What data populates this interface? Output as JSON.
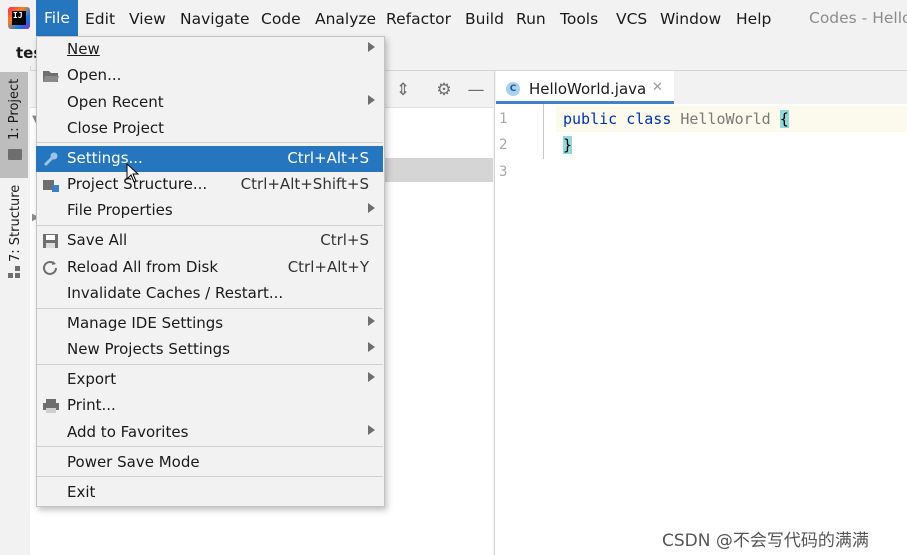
{
  "menubar": {
    "items": [
      "File",
      "Edit",
      "View",
      "Navigate",
      "Code",
      "Analyze",
      "Refactor",
      "Build",
      "Run",
      "Tools",
      "VCS",
      "Window",
      "Help"
    ],
    "window_title": "Codes - Hello"
  },
  "project": {
    "title": "tes",
    "tool_tabs": [
      "1: Project",
      "7: Structure"
    ]
  },
  "editor": {
    "tab_label": "HelloWorld.java",
    "tab_icon": "C",
    "line_numbers": [
      "1",
      "2",
      "3"
    ],
    "code_line1_kw1": "public",
    "code_line1_kw2": "class",
    "code_line1_name": "HelloWorld",
    "code_line1_brace": "{",
    "code_line2_brace": "}"
  },
  "file_menu": {
    "new": "New",
    "open": "Open...",
    "open_recent": "Open Recent",
    "close_project": "Close Project",
    "settings": "Settings...",
    "settings_sc": "Ctrl+Alt+S",
    "project_structure": "Project Structure...",
    "project_structure_sc": "Ctrl+Alt+Shift+S",
    "file_properties": "File Properties",
    "save_all": "Save All",
    "save_all_sc": "Ctrl+S",
    "reload": "Reload All from Disk",
    "reload_sc": "Ctrl+Alt+Y",
    "invalidate": "Invalidate Caches / Restart...",
    "manage_ide": "Manage IDE Settings",
    "new_projects": "New Projects Settings",
    "export": "Export",
    "print": "Print...",
    "favorites": "Add to Favorites",
    "power_save": "Power Save Mode",
    "exit": "Exit"
  },
  "watermark": "CSDN @不会写代码的满满",
  "colors": {
    "accent": "#2675bf",
    "brace_highlight": "#93d9d9",
    "keyword": "#0033b3"
  }
}
